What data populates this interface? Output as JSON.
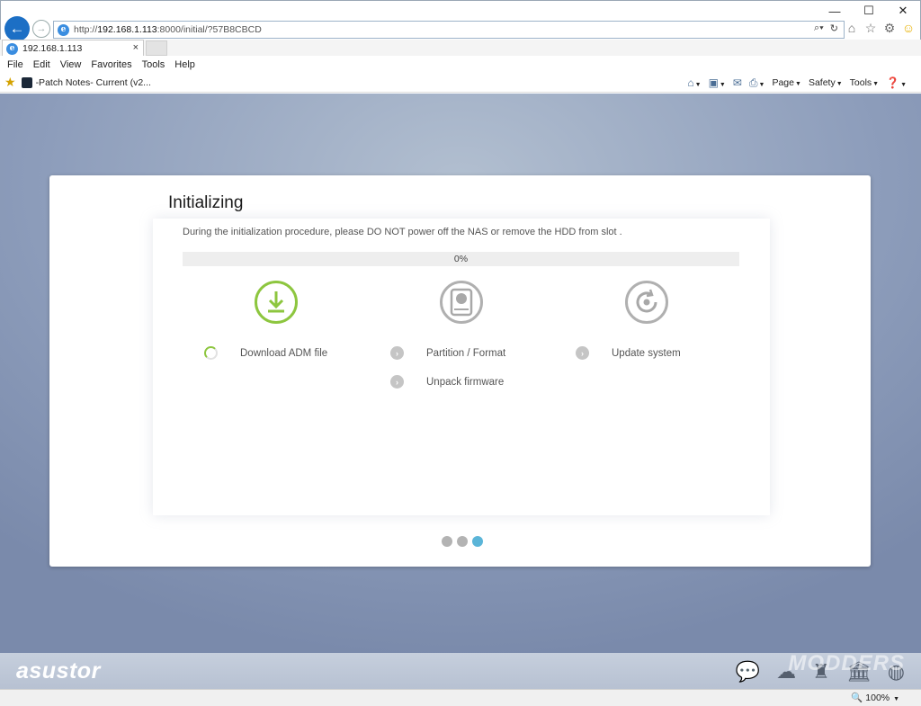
{
  "browser": {
    "url_prefix": "http://",
    "url_host": "192.168.1.113",
    "url_rest": ":8000/initial/?57B8CBCD",
    "tab_title": "192.168.1.113",
    "tab_close": "×",
    "window_buttons": {
      "minimize": "—",
      "maximize": "☐",
      "close": "✕"
    },
    "menu": [
      "File",
      "Edit",
      "View",
      "Favorites",
      "Tools",
      "Help"
    ],
    "favorites_link": "-Patch Notes- Current (v2...",
    "command_bar": {
      "page": "Page",
      "safety": "Safety",
      "tools": "Tools"
    },
    "zoom": "100%"
  },
  "wizard": {
    "title": "Initializing",
    "notice": "During the initialization procedure, please DO NOT power off the NAS or remove the HDD from slot .",
    "progress_text": "0%",
    "progress_value": 0,
    "steps": [
      {
        "label": "Download ADM file",
        "state": "in-progress"
      },
      {
        "label": "Partition / Format",
        "state": "pending"
      },
      {
        "label": "Unpack firmware",
        "state": "pending"
      },
      {
        "label": "Update system",
        "state": "pending"
      }
    ],
    "page_indicator": {
      "count": 3,
      "active": 3
    }
  },
  "footer": {
    "logo": "asustor",
    "watermark": "MODDERS"
  },
  "colors": {
    "accent_green": "#8dc63f",
    "indicator_active": "#5bb5d8",
    "ie_blue": "#1c6fc5"
  }
}
